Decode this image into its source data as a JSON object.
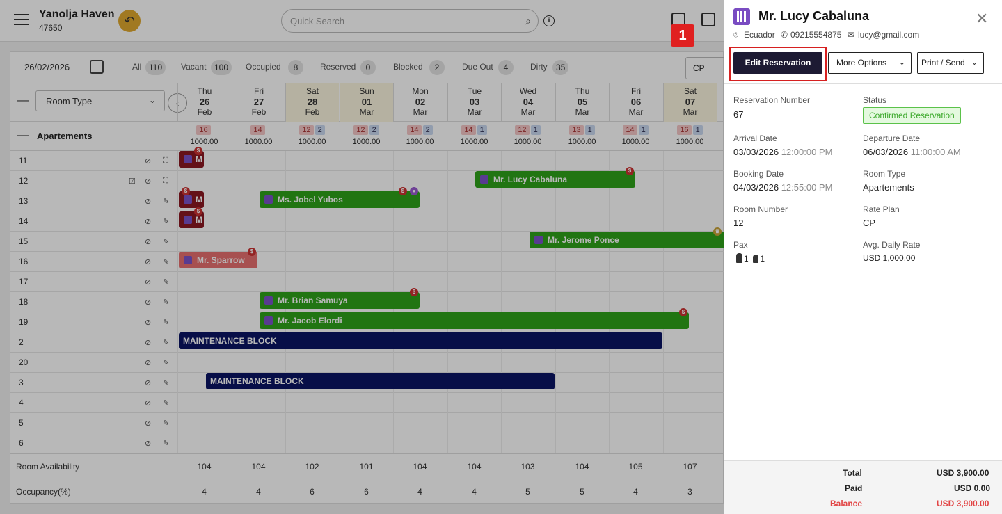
{
  "topbar": {
    "hotel_name": "Yanolja Haven",
    "hotel_id": "47650",
    "search_placeholder": "Quick Search"
  },
  "filters": {
    "date": "26/02/2026",
    "items": [
      {
        "label": "All",
        "count": "110"
      },
      {
        "label": "Vacant",
        "count": "100"
      },
      {
        "label": "Occupied",
        "count": "8"
      },
      {
        "label": "Reserved",
        "count": "0"
      },
      {
        "label": "Blocked",
        "count": "2"
      },
      {
        "label": "Due Out",
        "count": "4"
      },
      {
        "label": "Dirty",
        "count": "35"
      }
    ],
    "rate_plan": "CP"
  },
  "grid": {
    "room_type_label": "Room Type",
    "section_label": "Apartements",
    "days": [
      {
        "dow": "Thu",
        "d": "26",
        "m": "Feb",
        "red": "16",
        "blue": "",
        "price": "1000.00",
        "avail": "104",
        "occ": "4",
        "we": false
      },
      {
        "dow": "Fri",
        "d": "27",
        "m": "Feb",
        "red": "14",
        "blue": "",
        "price": "1000.00",
        "avail": "104",
        "occ": "4",
        "we": false
      },
      {
        "dow": "Sat",
        "d": "28",
        "m": "Feb",
        "red": "12",
        "blue": "2",
        "price": "1000.00",
        "avail": "102",
        "occ": "6",
        "we": true
      },
      {
        "dow": "Sun",
        "d": "01",
        "m": "Mar",
        "red": "12",
        "blue": "2",
        "price": "1000.00",
        "avail": "101",
        "occ": "6",
        "we": true
      },
      {
        "dow": "Mon",
        "d": "02",
        "m": "Mar",
        "red": "14",
        "blue": "2",
        "price": "1000.00",
        "avail": "104",
        "occ": "4",
        "we": false
      },
      {
        "dow": "Tue",
        "d": "03",
        "m": "Mar",
        "red": "14",
        "blue": "1",
        "price": "1000.00",
        "avail": "104",
        "occ": "4",
        "we": false
      },
      {
        "dow": "Wed",
        "d": "04",
        "m": "Mar",
        "red": "12",
        "blue": "1",
        "price": "1000.00",
        "avail": "103",
        "occ": "5",
        "we": false
      },
      {
        "dow": "Thu",
        "d": "05",
        "m": "Mar",
        "red": "13",
        "blue": "1",
        "price": "1000.00",
        "avail": "104",
        "occ": "5",
        "we": false
      },
      {
        "dow": "Fri",
        "d": "06",
        "m": "Mar",
        "red": "14",
        "blue": "1",
        "price": "1000.00",
        "avail": "105",
        "occ": "4",
        "we": false
      },
      {
        "dow": "Sat",
        "d": "07",
        "m": "Mar",
        "red": "16",
        "blue": "1",
        "price": "1000.00",
        "avail": "107",
        "occ": "3",
        "we": true
      }
    ],
    "rooms": [
      "11",
      "12",
      "13",
      "14",
      "15",
      "16",
      "17",
      "18",
      "19",
      "2",
      "20",
      "3",
      "4",
      "5",
      "6"
    ],
    "bookings": {
      "b1": "Mr. Lucy Cabaluna",
      "b2": "Ms. Jobel Yubos",
      "b3": "Mr. Jerome Ponce",
      "b4": "Mr. Sparrow",
      "b5": "Mr. Brian Samuya",
      "b6": "Mr. Jacob Elordi",
      "b7": "MAINTENANCE BLOCK",
      "b8": "MAINTENANCE BLOCK",
      "m1": "M",
      "m2": "M",
      "m3": "M"
    },
    "footer": {
      "avail_label": "Room Availability",
      "occ_label": "Occupancy(%)"
    }
  },
  "drawer": {
    "guest": "Mr. Lucy Cabaluna",
    "country": "Ecuador",
    "phone": "09215554875",
    "email": "lucy@gmail.com",
    "step": "1",
    "edit": "Edit Reservation",
    "more": "More Options",
    "print": "Print / Send",
    "res_no_label": "Reservation Number",
    "res_no": "67",
    "status_label": "Status",
    "status": "Confirmed Reservation",
    "arr_label": "Arrival Date",
    "arr_date": "03/03/2026",
    "arr_time": "12:00:00 PM",
    "dep_label": "Departure Date",
    "dep_date": "06/03/2026",
    "dep_time": "11:00:00 AM",
    "book_label": "Booking Date",
    "book_date": "04/03/2026",
    "book_time": "12:55:00 PM",
    "rt_label": "Room Type",
    "rt": "Apartements",
    "rn_label": "Room Number",
    "rn": "12",
    "rp_label": "Rate Plan",
    "rp": "CP",
    "pax_label": "Pax",
    "adults": "1",
    "children": "1",
    "adr_label": "Avg. Daily Rate",
    "adr": "USD 1,000.00",
    "total_label": "Total",
    "total": "USD 3,900.00",
    "paid_label": "Paid",
    "paid": "USD 0.00",
    "bal_label": "Balance",
    "bal": "USD 3,900.00"
  },
  "colors": {
    "green": "#2ea21a",
    "navy": "#0a1464",
    "maroon": "#8b1822",
    "pink": "#e87070",
    "accent": "#e02020"
  }
}
